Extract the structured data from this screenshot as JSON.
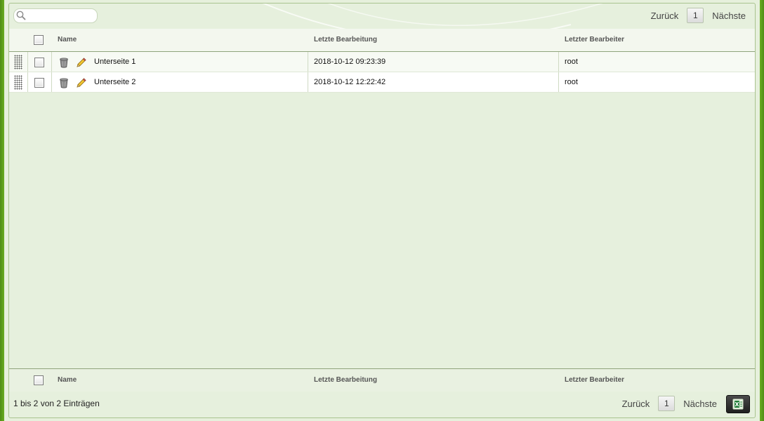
{
  "search": {
    "placeholder": "",
    "value": ""
  },
  "pager": {
    "prev_label": "Zurück",
    "page": "1",
    "next_label": "Nächste"
  },
  "columns": [
    {
      "label": "Name"
    },
    {
      "label": "Letzte Bearbeitung"
    },
    {
      "label": "Letzter Bearbeiter"
    }
  ],
  "rows": [
    {
      "name": "Unterseite 1",
      "modified": "2018-10-12 09:23:39",
      "editor": "root"
    },
    {
      "name": "Unterseite 2",
      "modified": "2018-10-12 12:22:42",
      "editor": "root"
    }
  ],
  "footer": {
    "info": "1 bis 2 von 2 Einträgen"
  },
  "icons": {
    "search": "search-icon",
    "drag": "drag-handle-icon",
    "delete": "trash-icon",
    "edit": "pencil-icon",
    "export": "excel-export-icon"
  },
  "colors": {
    "frame": "#5a9a1c",
    "panel": "#e6f0dd",
    "header": "#f3f7ee"
  }
}
